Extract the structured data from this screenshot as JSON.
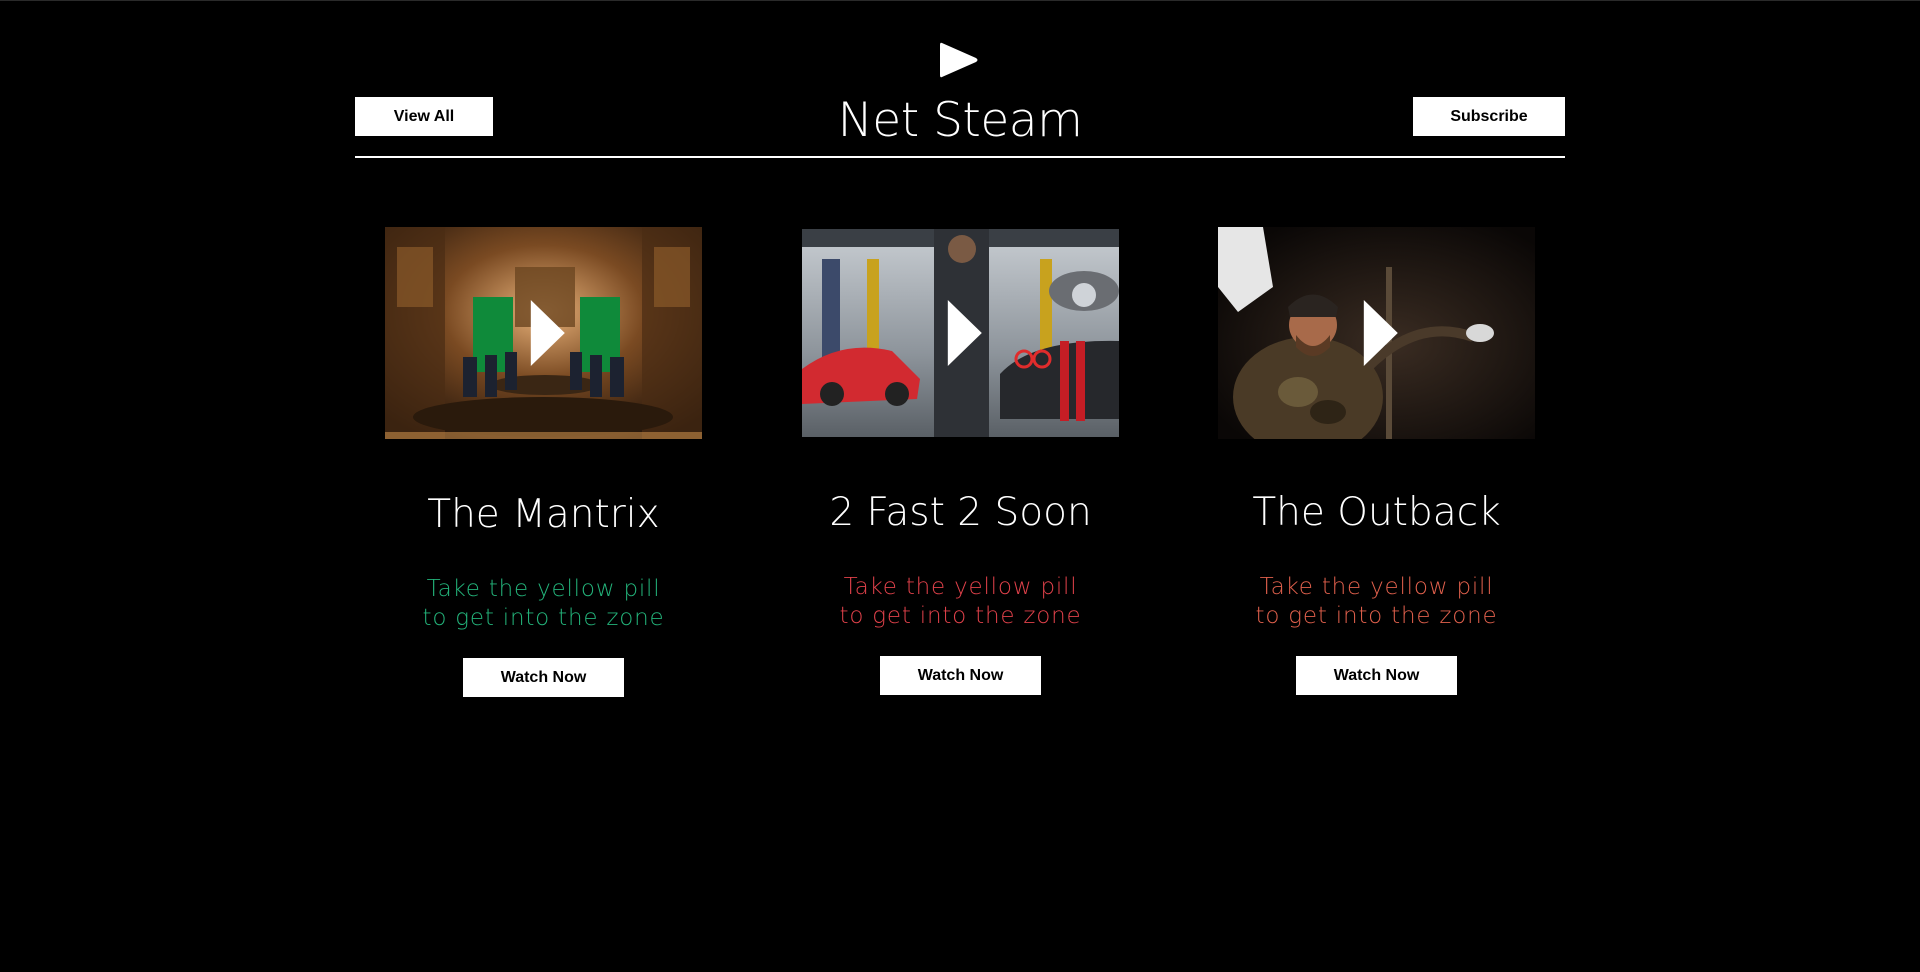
{
  "header": {
    "title": "Net Steam",
    "view_all_label": "View All",
    "subscribe_label": "Subscribe",
    "logo_icon": "play-icon"
  },
  "cards": [
    {
      "title": "The Mantrix",
      "description_line1": "Take the yellow pill",
      "description_line2": "to get into the zone",
      "description_color": "#23b37a",
      "button_label": "Watch Now",
      "icon": "play-icon"
    },
    {
      "title": "2 Fast 2 Soon",
      "description_line1": "Take the yellow pill",
      "description_line2": "to get into the zone",
      "description_color": "#e0414a",
      "button_label": "Watch Now",
      "icon": "play-icon"
    },
    {
      "title": "The Outback",
      "description_line1": "Take the yellow pill",
      "description_line2": "to get into the zone",
      "description_color": "#e0604c",
      "button_label": "Watch Now",
      "icon": "play-icon"
    }
  ],
  "colors": {
    "background": "#000000",
    "text": "#ffffff",
    "button_bg": "#ffffff",
    "button_text": "#000000"
  }
}
